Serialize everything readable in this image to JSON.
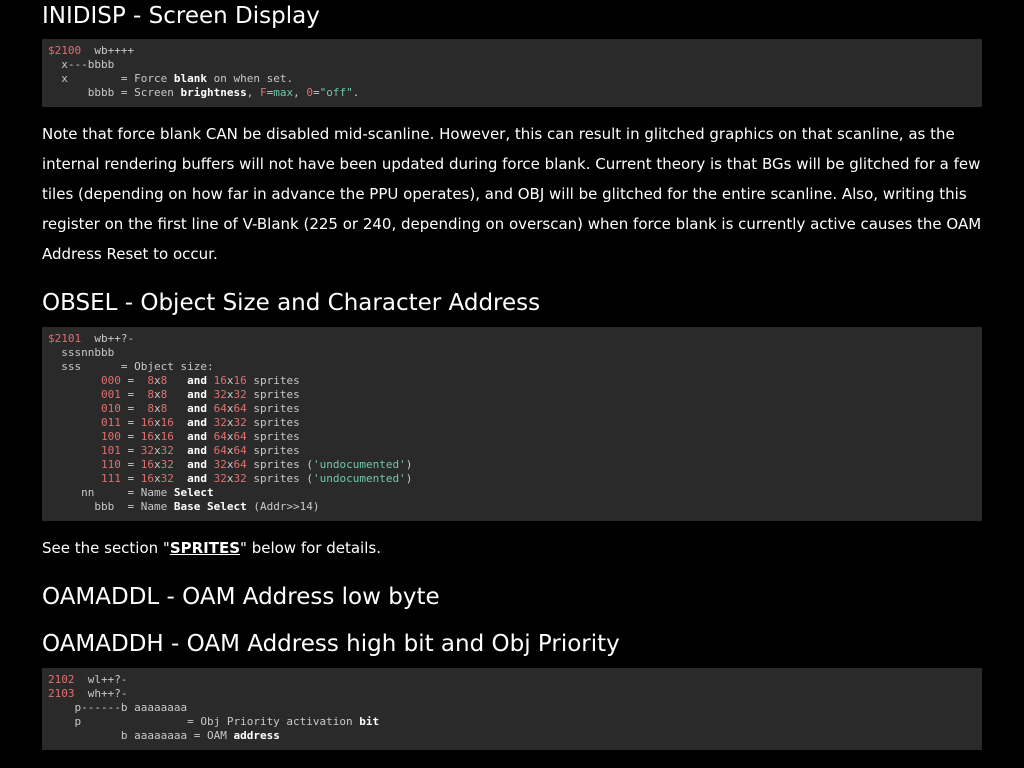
{
  "sections": {
    "inidisp": {
      "title": "INIDISP - Screen Display",
      "addr": "$2100",
      "flags": "wb++++",
      "bits": "x---bbbb",
      "x_key": "x",
      "x_desc_pre": "= Force ",
      "x_desc_kw": "blank",
      "x_desc_post": " on when set.",
      "b_key": "bbbb",
      "b_desc_pre": "= Screen ",
      "b_desc_kw": "brightness",
      "b_desc_mid1": ", ",
      "b_desc_f": "F",
      "b_desc_eq1": "=",
      "b_desc_max": "max",
      "b_desc_mid2": ", ",
      "b_desc_zero": "0",
      "b_desc_eq2": "=",
      "b_desc_off": "\"off\"",
      "b_desc_end": ".",
      "note": "Note that force blank CAN be disabled mid-scanline. However, this can result in glitched graphics on that scanline, as the internal rendering buffers will not have been updated during force blank. Current theory is that BGs will be glitched for a few tiles (depending on how far in advance the PPU operates), and OBJ will be glitched for the entire scanline. Also, writing this register on the first line of V-Blank (225 or 240, depending on overscan) when force blank is currently active causes the OAM Address Reset to occur."
    },
    "obsel": {
      "title": "OBSEL - Object Size and Character Address",
      "addr": "$2101",
      "flags": "wb++?-",
      "bits": "sssnnbbb",
      "sss_key": "sss",
      "sss_desc": "= Object size:",
      "rows": [
        {
          "code": "000",
          "a": " 8",
          "ax": "x",
          "a2": "8 ",
          "b": "16",
          "bx": "x",
          "b2": "16",
          "note": ""
        },
        {
          "code": "001",
          "a": " 8",
          "ax": "x",
          "a2": "8 ",
          "b": "32",
          "bx": "x",
          "b2": "32",
          "note": ""
        },
        {
          "code": "010",
          "a": " 8",
          "ax": "x",
          "a2": "8 ",
          "b": "64",
          "bx": "x",
          "b2": "64",
          "note": ""
        },
        {
          "code": "011",
          "a": "16",
          "ax": "x",
          "a2": "16",
          "b": "32",
          "bx": "x",
          "b2": "32",
          "note": ""
        },
        {
          "code": "100",
          "a": "16",
          "ax": "x",
          "a2": "16",
          "b": "64",
          "bx": "x",
          "b2": "64",
          "note": ""
        },
        {
          "code": "101",
          "a": "32",
          "ax": "x",
          "a2": "32",
          "b": "64",
          "bx": "x",
          "b2": "64",
          "note": ""
        },
        {
          "code": "110",
          "a": "16",
          "ax": "x",
          "a2": "32",
          "b": "32",
          "bx": "x",
          "b2": "64",
          "note": "'undocumented'"
        },
        {
          "code": "111",
          "a": "16",
          "ax": "x",
          "a2": "32",
          "b": "32",
          "bx": "x",
          "b2": "32",
          "note": "'undocumented'"
        }
      ],
      "and_word": "and",
      "sprites_word": "sprites",
      "nn_key": "nn",
      "nn_desc_pre": "= Name ",
      "nn_desc_kw": "Select",
      "bbb_key": "bbb",
      "bbb_desc_pre": "= Name ",
      "bbb_desc_kw": "Base Select",
      "bbb_desc_post": " (Addr>>14)",
      "see_pre": "See the section \"",
      "see_link": "SPRITES",
      "see_post": "\" below for details."
    },
    "oamaddl": {
      "title": "OAMADDL - OAM Address low byte"
    },
    "oamaddh": {
      "title": "OAMADDH - OAM Address high bit and Obj Priority",
      "addr1": "2102",
      "flags1": "wl++?-",
      "addr2": "2103",
      "flags2": "wh++?-",
      "bits": "p------b aaaaaaaa",
      "p_key": "p",
      "p_desc_pre": "= Obj Priority activation ",
      "p_desc_kw": "bit",
      "ba_key": "b aaaaaaaa",
      "ba_desc_pre": "= OAM ",
      "ba_desc_kw": "address"
    }
  }
}
